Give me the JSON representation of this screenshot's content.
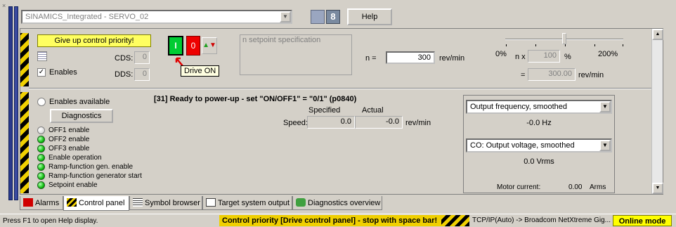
{
  "device": {
    "name": "SINAMICS_Integrated - SERVO_02"
  },
  "toolbar": {
    "help_label": "Help",
    "num_icon_text": "8"
  },
  "control": {
    "give_up_label": "Give up control priority!",
    "cds_label": "CDS:",
    "cds_value": "0",
    "dds_label": "DDS:",
    "dds_value": "0",
    "enables_label": "Enables",
    "enables_checked": "✓",
    "on_label": "I",
    "off_label": "0",
    "jog_label": "▲▼",
    "tooltip": "Drive ON",
    "setpoint_spec": "n setpoint specification",
    "n_label": "n =",
    "n_value": "300",
    "n_unit": "rev/min"
  },
  "slider": {
    "min_label": "0%",
    "max_label": "200%",
    "nx_label": "n x",
    "nx_value": "100",
    "pct_unit": "%",
    "eq_label": "=",
    "rpm_value": "300.00",
    "rpm_unit": "rev/min",
    "position_fraction": 0.5
  },
  "enables": {
    "available_label": "Enables available",
    "diagnostics_label": "Diagnostics",
    "items": [
      {
        "label": "OFF1 enable",
        "state": "off"
      },
      {
        "label": "OFF2 enable",
        "state": "on"
      },
      {
        "label": "OFF3 enable",
        "state": "on"
      },
      {
        "label": "Enable operation",
        "state": "on"
      },
      {
        "label": "Ramp-function gen. enable",
        "state": "on"
      },
      {
        "label": "Ramp-function generator start",
        "state": "on"
      },
      {
        "label": "Setpoint enable",
        "state": "on"
      }
    ]
  },
  "status": {
    "line": "[31] Ready to power-up - set \"ON/OFF1\" = \"0/1\" (p0840)",
    "specified_header": "Specified",
    "actual_header": "Actual",
    "speed_label": "Speed:",
    "speed_specified": "0.0",
    "speed_actual": "-0.0",
    "speed_unit": "rev/min"
  },
  "monitor": {
    "combo1": "Output frequency, smoothed",
    "value1": "-0.0 Hz",
    "combo2": "CO: Output voltage, smoothed",
    "value2": "0.0 Vrms",
    "motor_current_label": "Motor current:",
    "motor_current_value": "0.00",
    "motor_current_unit": "Arms"
  },
  "tabs": [
    {
      "label": "Alarms",
      "icon": "alarm-icon"
    },
    {
      "label": "Control panel",
      "icon": "control-panel-icon",
      "active": true
    },
    {
      "label": "Symbol browser",
      "icon": "symbol-browser-icon"
    },
    {
      "label": "Target system output",
      "icon": "target-output-icon"
    },
    {
      "label": "Diagnostics overview",
      "icon": "diagnostics-icon"
    }
  ],
  "statusbar": {
    "help": "Press F1 to open Help display.",
    "priority": "Control priority [Drive control panel] - stop with space bar!",
    "connection": "TCP/IP(Auto) -> Broadcom NetXtreme Gig...",
    "mode": "Online mode"
  }
}
